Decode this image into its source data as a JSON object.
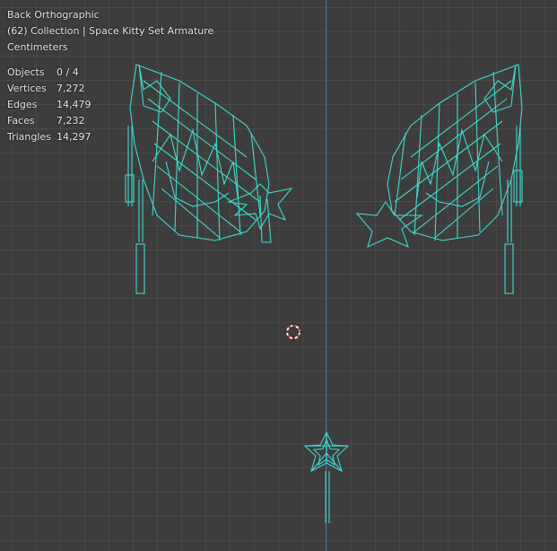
{
  "viewport": {
    "view_name": "Back Orthographic",
    "collection": "(62) Collection | Space Kitty Set Armature",
    "units": "Centimeters"
  },
  "stats": [
    {
      "label": "Objects",
      "value": "0 / 4"
    },
    {
      "label": "Vertices",
      "value": "7,272"
    },
    {
      "label": "Edges",
      "value": "14,479"
    },
    {
      "label": "Faces",
      "value": "7,232"
    },
    {
      "label": "Triangles",
      "value": "14,297"
    }
  ],
  "colors": {
    "wireframe": "#3fd9cf",
    "background": "#3d3d3d",
    "z_axis": "#3f6fb0"
  }
}
